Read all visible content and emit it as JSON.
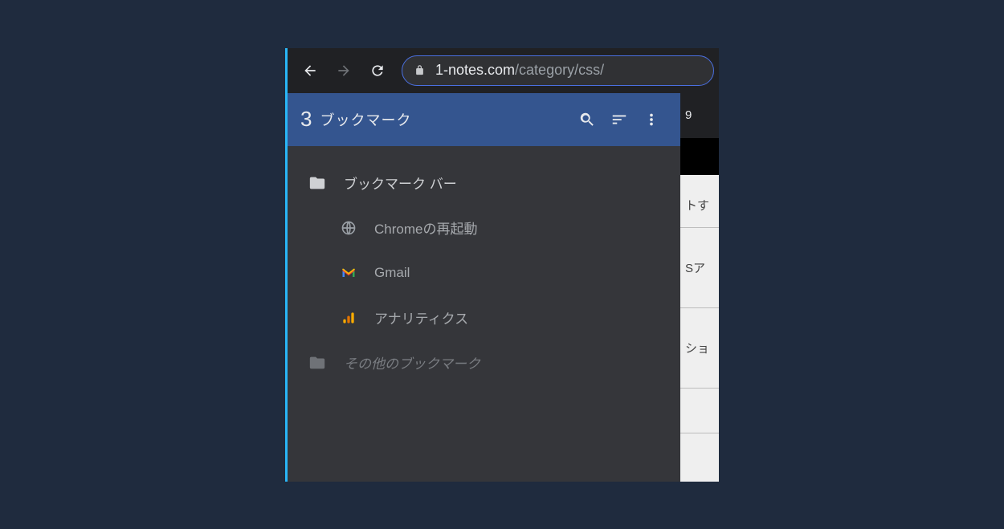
{
  "toolbar": {
    "url_host": "1-notes.com",
    "url_path": "/category/css/"
  },
  "panel": {
    "count": "3",
    "title": "ブックマーク"
  },
  "folders": {
    "bar_label": "ブックマーク バー",
    "other_label": "その他のブックマーク"
  },
  "bookmarks": {
    "chrome_restart": "Chromeの再起動",
    "gmail": "Gmail",
    "analytics": "アナリティクス"
  },
  "bg": {
    "c1": "9",
    "c2": "トす",
    "c3": "Sア",
    "c4": "ショ"
  }
}
